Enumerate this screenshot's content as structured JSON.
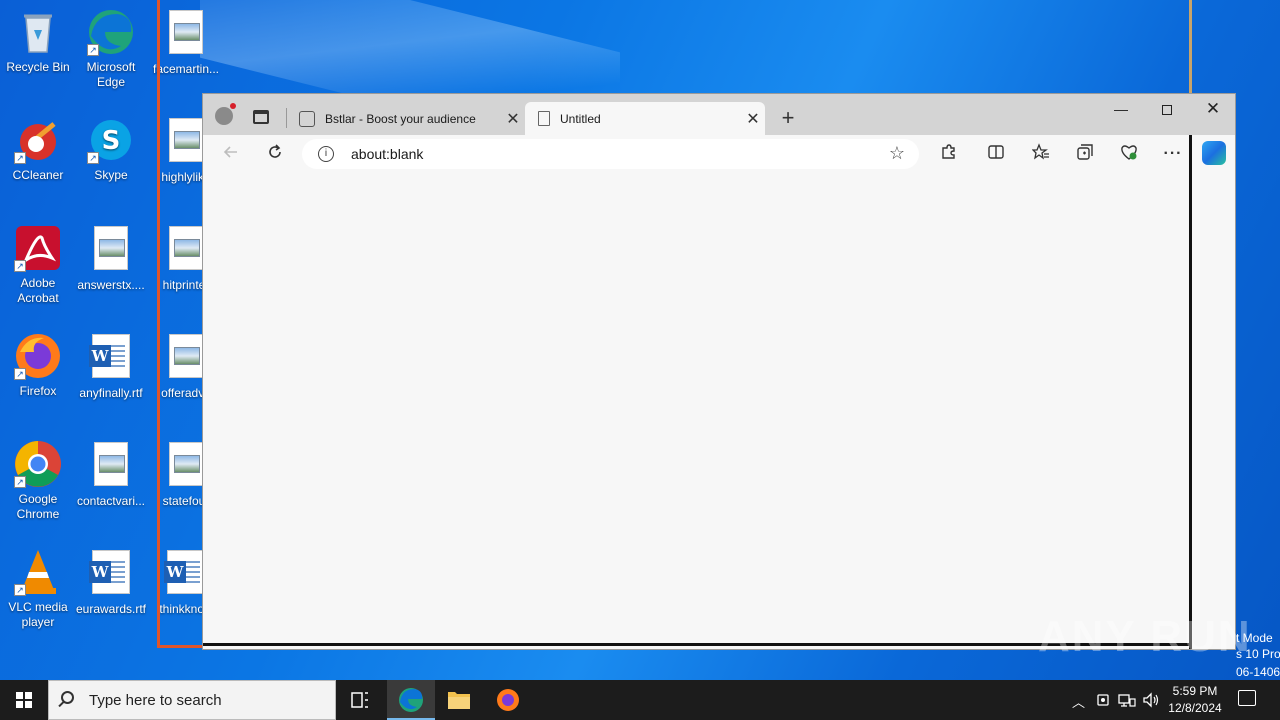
{
  "desktop": {
    "icons": [
      {
        "label": "Recycle Bin",
        "type": "recycle"
      },
      {
        "label": "Microsoft Edge",
        "type": "edge"
      },
      {
        "label": "facemartin...",
        "type": "image"
      },
      {
        "label": "CCleaner",
        "type": "ccleaner"
      },
      {
        "label": "Skype",
        "type": "skype"
      },
      {
        "label": "highlylike",
        "type": "image"
      },
      {
        "label": "Adobe Acrobat",
        "type": "acrobat"
      },
      {
        "label": "answerstx....",
        "type": "image"
      },
      {
        "label": "hitprinter",
        "type": "image"
      },
      {
        "label": "Firefox",
        "type": "firefox"
      },
      {
        "label": "anyfinally.rtf",
        "type": "word"
      },
      {
        "label": "offeradve",
        "type": "image"
      },
      {
        "label": "Google Chrome",
        "type": "chrome"
      },
      {
        "label": "contactvari...",
        "type": "image"
      },
      {
        "label": "statefour",
        "type": "image"
      },
      {
        "label": "VLC media player",
        "type": "vlc"
      },
      {
        "label": "eurawards.rtf",
        "type": "word"
      },
      {
        "label": "thinkknow",
        "type": "word"
      }
    ]
  },
  "browser": {
    "tabs": [
      {
        "title": "Bstlar - Boost your audience",
        "close": "✕"
      },
      {
        "title": "Untitled",
        "close": "✕"
      }
    ],
    "new_tab": "+",
    "window_buttons": {
      "minimize": "—",
      "close": "✕"
    },
    "address": {
      "url": "about:blank",
      "info": "i"
    },
    "toolbar_icons": [
      "back-icon",
      "refresh-icon",
      "extensions-icon",
      "split-screen-icon",
      "favorites-icon",
      "collections-icon",
      "browser-essentials-icon",
      "more-icon"
    ]
  },
  "watermark": {
    "text": "ANY RUN"
  },
  "side_text": [
    "t Mode",
    "s 10 Pro",
    "06-1406"
  ],
  "taskbar": {
    "search_placeholder": "Type here to search",
    "time": "5:59 PM",
    "date": "12/8/2024"
  },
  "colors": {
    "accent": "#0b76e4",
    "taskbar": "#1c1c1c",
    "orange_line": "#e0552a"
  }
}
